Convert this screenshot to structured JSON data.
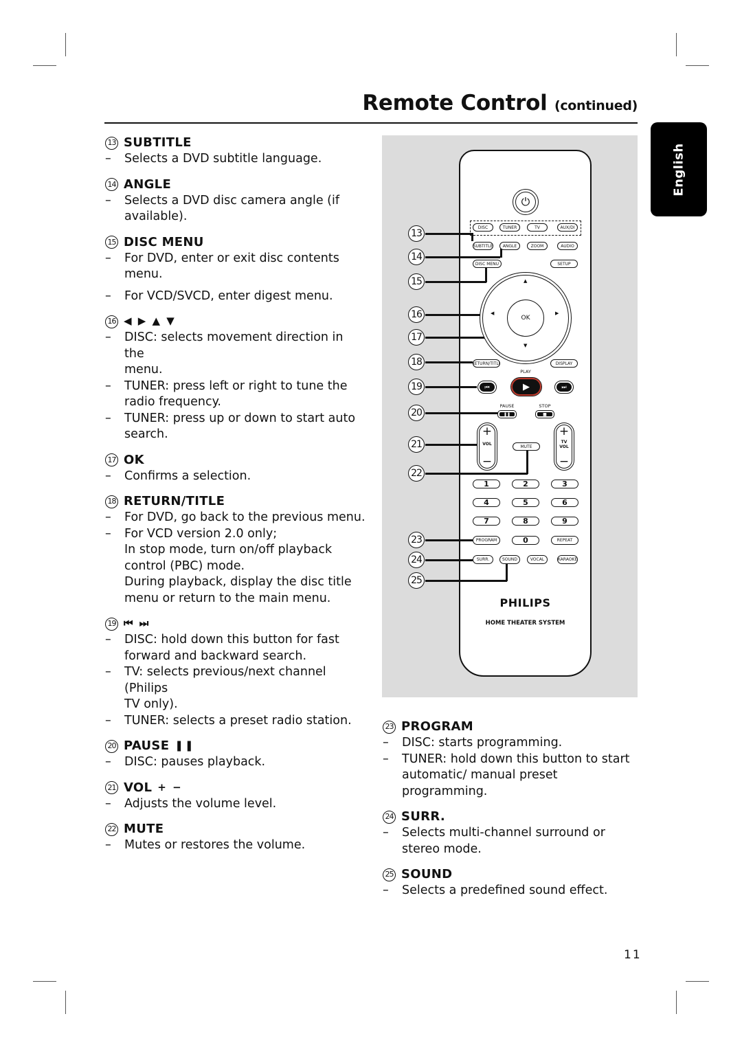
{
  "header": {
    "title": "Remote Control",
    "title_suffix": "(continued)"
  },
  "language_tab": "English",
  "page_number": "11",
  "left_column": [
    {
      "num": "13",
      "label": "SUBTITLE",
      "symbol": "",
      "lines": [
        {
          "dash": true,
          "text": "Selects a DVD subtitle language."
        }
      ]
    },
    {
      "num": "14",
      "label": "ANGLE",
      "symbol": "",
      "lines": [
        {
          "dash": true,
          "text": "Selects a DVD disc camera angle (if"
        },
        {
          "dash": false,
          "text": "available)."
        }
      ]
    },
    {
      "num": "15",
      "label": "DISC MENU",
      "symbol": "",
      "lines": [
        {
          "dash": true,
          "text": "For DVD, enter or exit disc contents"
        },
        {
          "dash": false,
          "text": "menu."
        },
        {
          "dash": true,
          "text": "For VCD/SVCD, enter digest menu.",
          "gap": true
        }
      ]
    },
    {
      "num": "16",
      "label": "",
      "symbol": "◀ ▶ ▲ ▼",
      "lines": [
        {
          "dash": true,
          "text": "DISC: selects movement direction in the"
        },
        {
          "dash": false,
          "text": "menu."
        },
        {
          "dash": true,
          "text": "TUNER: press left or right to tune the"
        },
        {
          "dash": false,
          "text": "radio frequency."
        },
        {
          "dash": true,
          "text": "TUNER: press up or down to start auto"
        },
        {
          "dash": false,
          "text": "search."
        }
      ]
    },
    {
      "num": "17",
      "label": "OK",
      "symbol": "",
      "lines": [
        {
          "dash": true,
          "text": "Confirms a selection."
        }
      ]
    },
    {
      "num": "18",
      "label": "RETURN/TITLE",
      "symbol": "",
      "lines": [
        {
          "dash": true,
          "text": "For DVD, go back to the previous menu."
        },
        {
          "dash": true,
          "text": "For VCD version 2.0 only;"
        },
        {
          "dash": false,
          "text": "In stop mode, turn on/off playback"
        },
        {
          "dash": false,
          "text": "control (PBC) mode."
        },
        {
          "dash": false,
          "text": "During playback, display the disc title"
        },
        {
          "dash": false,
          "text": "menu or return to the main menu."
        }
      ]
    },
    {
      "num": "19",
      "label": "",
      "symbol": "⏮ ⏭",
      "lines": [
        {
          "dash": true,
          "text": "DISC: hold down this button for fast"
        },
        {
          "dash": false,
          "text": "forward and backward search."
        },
        {
          "dash": true,
          "text": "TV: selects previous/next channel (Philips"
        },
        {
          "dash": false,
          "text": "TV only)."
        },
        {
          "dash": true,
          "text": "TUNER:  selects a preset radio station."
        }
      ]
    },
    {
      "num": "20",
      "label": "PAUSE",
      "symbol": "❚❚",
      "lines": [
        {
          "dash": true,
          "text": "DISC: pauses playback."
        }
      ]
    },
    {
      "num": "21",
      "label": "VOL",
      "symbol": "+ −",
      "lines": [
        {
          "dash": true,
          "text": "Adjusts the volume level."
        }
      ]
    },
    {
      "num": "22",
      "label": "MUTE",
      "symbol": "",
      "lines": [
        {
          "dash": true,
          "text": "Mutes or restores the volume."
        }
      ]
    }
  ],
  "right_column": [
    {
      "num": "23",
      "label": "PROGRAM",
      "symbol": "",
      "lines": [
        {
          "dash": true,
          "text": "DISC: starts programming."
        },
        {
          "dash": true,
          "text": "TUNER: hold down this button to start"
        },
        {
          "dash": false,
          "text": "automatic/ manual preset programming."
        }
      ]
    },
    {
      "num": "24",
      "label": "SURR.",
      "symbol": "",
      "lines": [
        {
          "dash": true,
          "text": "Selects multi-channel surround or"
        },
        {
          "dash": false,
          "text": "stereo mode."
        }
      ]
    },
    {
      "num": "25",
      "label": "SOUND",
      "symbol": "",
      "lines": [
        {
          "dash": true,
          "text": "Selects a predefined sound effect."
        }
      ]
    }
  ],
  "remote": {
    "callouts": [
      "13",
      "14",
      "15",
      "16",
      "17",
      "18",
      "19",
      "20",
      "21",
      "22",
      "23",
      "24",
      "25"
    ],
    "power_icon": "⏻",
    "source_buttons": [
      "DISC",
      "TUNER",
      "TV",
      "AUX/DI"
    ],
    "row2_buttons": [
      "SUBTITLE",
      "ANGLE",
      "ZOOM",
      "AUDIO"
    ],
    "disc_menu": "DISC MENU",
    "setup": "SETUP",
    "ok": "OK",
    "arrows": {
      "up": "▲",
      "down": "▼",
      "left": "◀",
      "right": "▶"
    },
    "return_title": "RETURN/TITLE",
    "display": "DISPLAY",
    "play_label": "PLAY",
    "play_icon": "▶",
    "prev_icon": "⏮",
    "next_icon": "⏭",
    "pause_label": "PAUSE",
    "pause_icon": "❚❚",
    "stop_label": "STOP",
    "stop_icon": "■",
    "vol_plus": "+",
    "vol_minus": "−",
    "vol_label": "VOL",
    "tv_vol_label_1": "TV",
    "tv_vol_label_2": "VOL",
    "mute": "MUTE",
    "numpad": [
      "1",
      "2",
      "3",
      "4",
      "5",
      "6",
      "7",
      "8",
      "9"
    ],
    "program": "PROGRAM",
    "zero": "0",
    "repeat": "REPEAT",
    "bottom_buttons": [
      "SURR.",
      "SOUND",
      "VOCAL",
      "KARAOKE"
    ],
    "brand": "PHILIPS",
    "brand_sub": "HOME THEATER SYSTEM"
  },
  "colors": {
    "panel_bg": "#dcdcdc",
    "play_accent": "#c0392b",
    "tab_bg": "#000000"
  }
}
